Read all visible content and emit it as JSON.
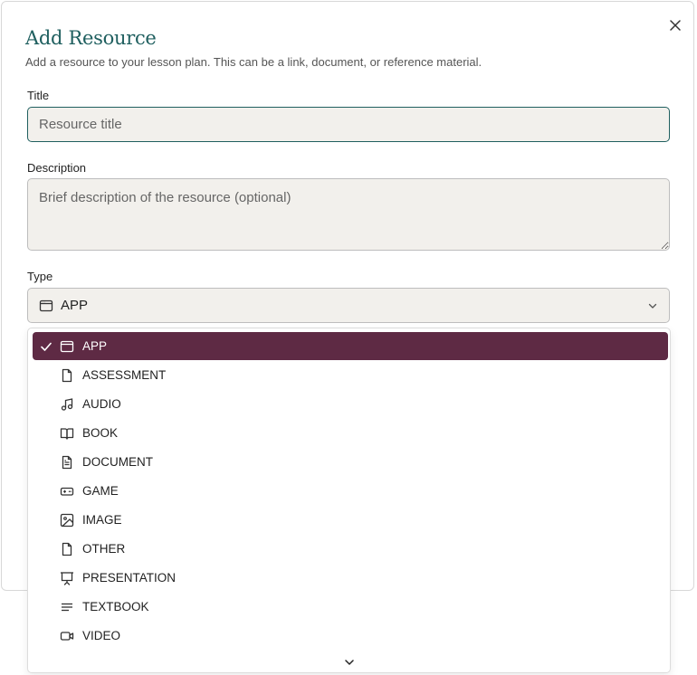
{
  "dialog": {
    "title": "Add Resource",
    "subtitle": "Add a resource to your lesson plan. This can be a link, document, or reference material."
  },
  "form": {
    "title_label": "Title",
    "title_placeholder": "Resource title",
    "description_label": "Description",
    "description_placeholder": "Brief description of the resource (optional)",
    "type_label": "Type",
    "type_selected": "APP"
  },
  "type_options": [
    {
      "label": "APP",
      "icon": "app-window-icon",
      "selected": true
    },
    {
      "label": "ASSESSMENT",
      "icon": "file-icon",
      "selected": false
    },
    {
      "label": "AUDIO",
      "icon": "music-note-icon",
      "selected": false
    },
    {
      "label": "BOOK",
      "icon": "open-book-icon",
      "selected": false
    },
    {
      "label": "DOCUMENT",
      "icon": "file-text-icon",
      "selected": false
    },
    {
      "label": "GAME",
      "icon": "gamepad-icon",
      "selected": false
    },
    {
      "label": "IMAGE",
      "icon": "image-icon",
      "selected": false
    },
    {
      "label": "OTHER",
      "icon": "file-icon",
      "selected": false
    },
    {
      "label": "PRESENTATION",
      "icon": "presentation-icon",
      "selected": false
    },
    {
      "label": "TEXTBOOK",
      "icon": "text-lines-icon",
      "selected": false
    },
    {
      "label": "VIDEO",
      "icon": "video-camera-icon",
      "selected": false
    }
  ],
  "colors": {
    "accent": "#1f5f5f",
    "selected_option_bg": "#5e2a44",
    "field_bg": "#f2f0ec"
  }
}
